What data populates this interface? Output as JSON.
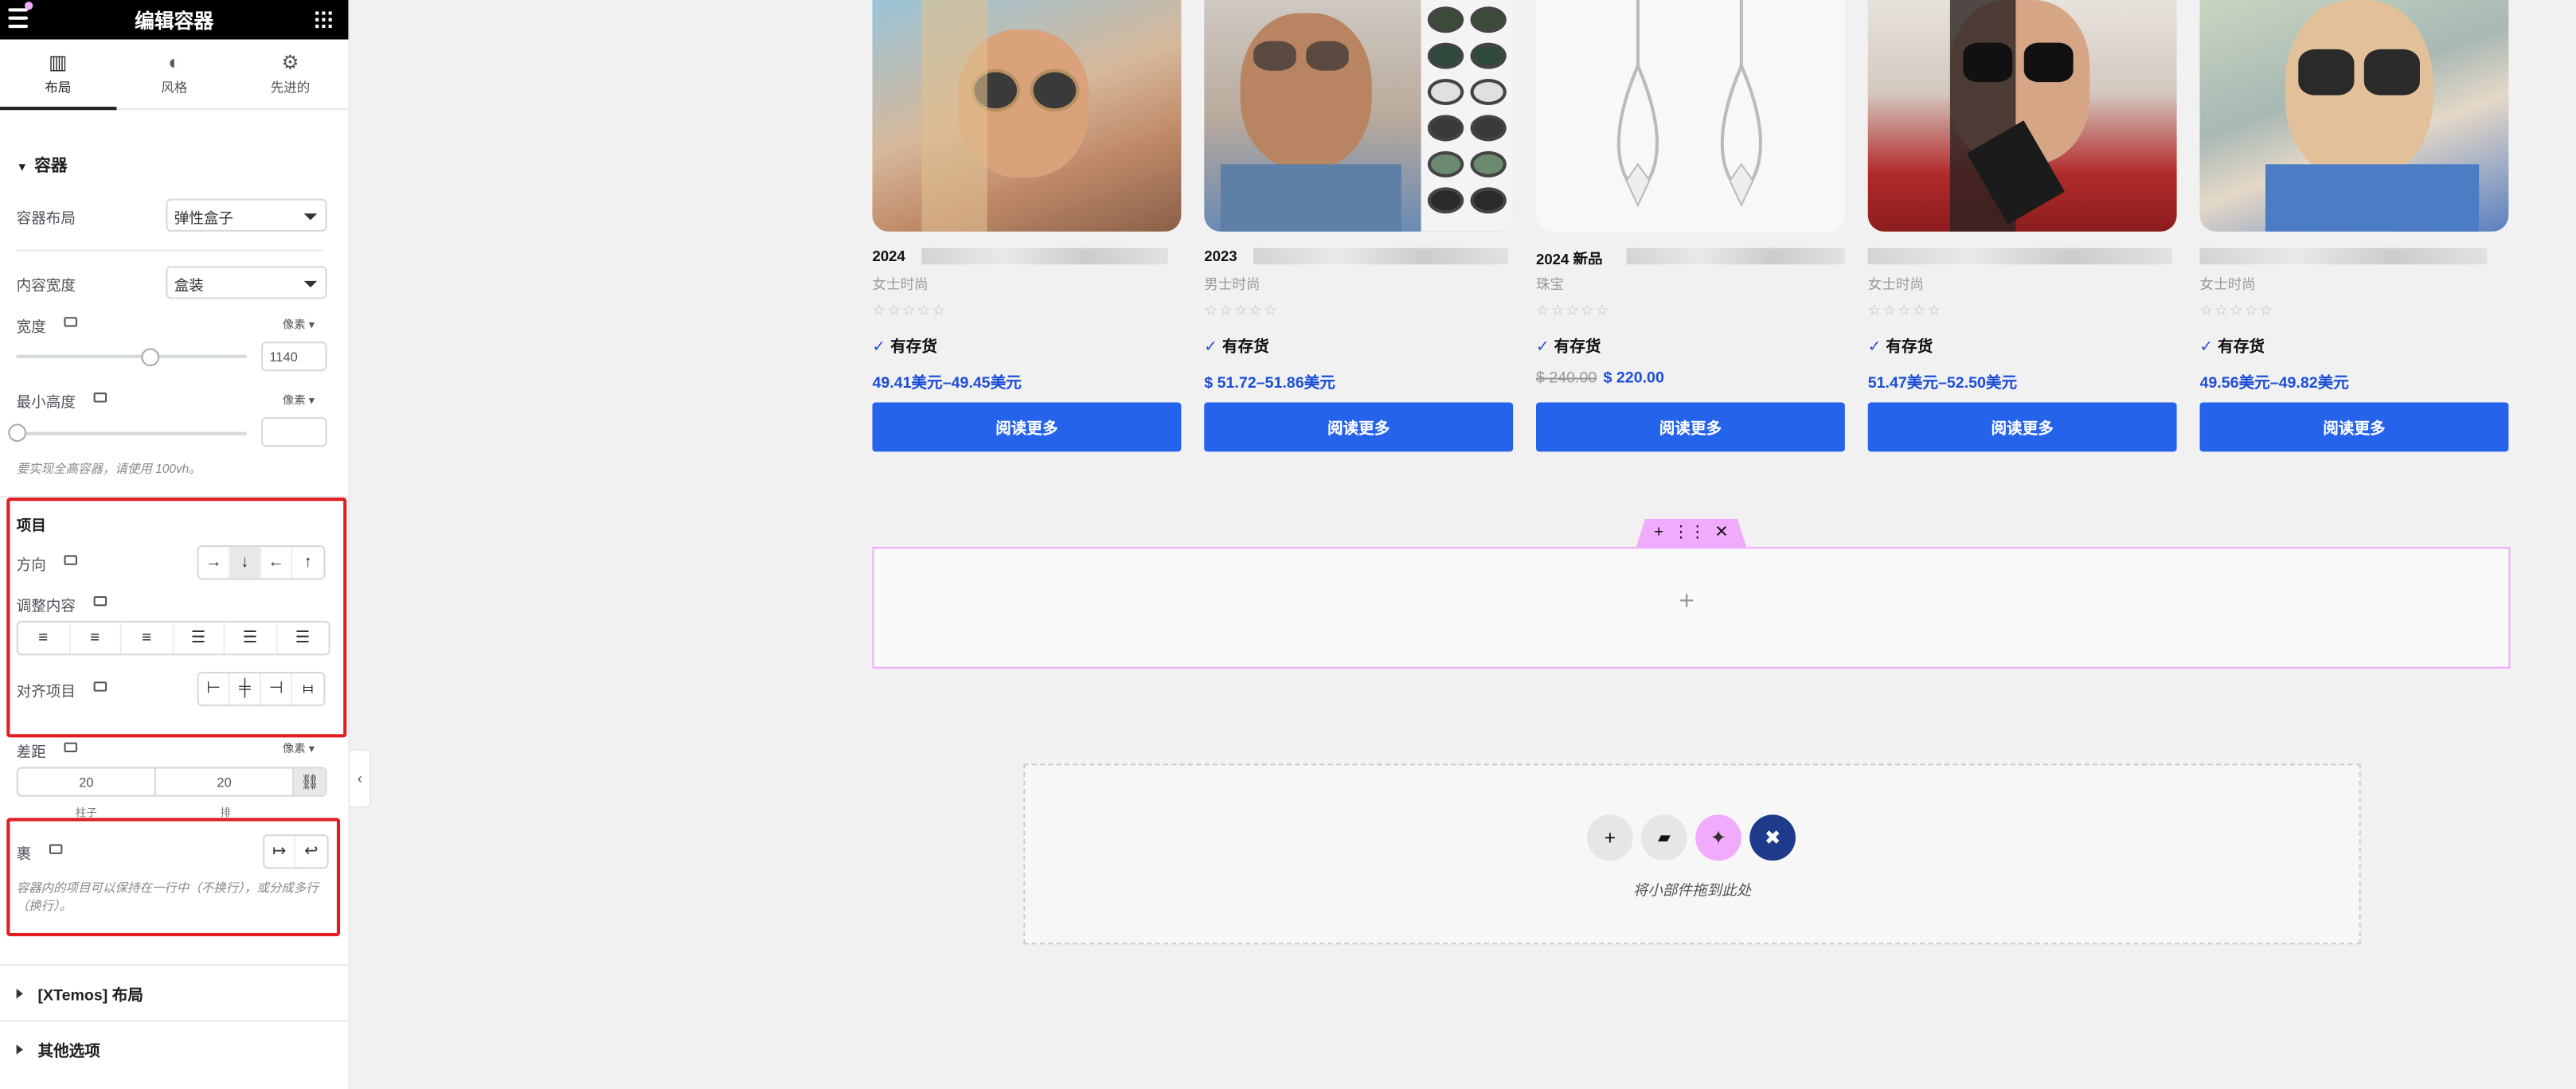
{
  "panel": {
    "title": "编辑容器",
    "tabs": [
      {
        "label": "布局",
        "icon": "layout-icon"
      },
      {
        "label": "风格",
        "icon": "half-circle-icon"
      },
      {
        "label": "先进的",
        "icon": "gear-icon"
      }
    ],
    "section_title": "容器",
    "container_layout": {
      "label": "容器布局",
      "value": "弹性盒子"
    },
    "content_width": {
      "label": "内容宽度",
      "value": "盒装"
    },
    "width": {
      "label": "宽度",
      "unit": "像素",
      "value": "1140",
      "slider_fraction": 0.58
    },
    "min_height": {
      "label": "最小高度",
      "unit": "像素",
      "value": "",
      "slider_fraction": 0
    },
    "min_height_note": "要实现全高容器，请使用 100vh。",
    "items_title": "项目",
    "direction": {
      "label": "方向",
      "options": [
        "→",
        "↓",
        "←",
        "↑"
      ],
      "selected": 1
    },
    "justify": {
      "label": "调整内容"
    },
    "align": {
      "label": "对齐项目"
    },
    "gap": {
      "label": "差距",
      "unit": "像素",
      "column_value": "20",
      "row_value": "20",
      "column_label": "柱子",
      "row_label": "排"
    },
    "wrap": {
      "label": "裹",
      "note": "容器内的项目可以保持在一行中（不换行），或分成多行（换行）。"
    },
    "collapsed_sections": [
      "[XTemos] 布局",
      "其他选项"
    ]
  },
  "products": [
    {
      "title": "2024",
      "category": "女士时尚",
      "stock": "有存货",
      "price": "49.41美元–49.45美元",
      "old_price": "",
      "button": "阅读更多"
    },
    {
      "title": "2023",
      "category": "男士时尚",
      "stock": "有存货",
      "price": "$ 51.72–51.86美元",
      "old_price": "",
      "button": "阅读更多"
    },
    {
      "title": "2024 新品",
      "category": "珠宝",
      "stock": "有存货",
      "price": "$ 220.00",
      "old_price": "$ 240.00",
      "button": "阅读更多"
    },
    {
      "title": "",
      "category": "女士时尚",
      "stock": "有存货",
      "price": "51.47美元–52.50美元",
      "old_price": "",
      "button": "阅读更多"
    },
    {
      "title": "",
      "category": "女士时尚",
      "stock": "有存货",
      "price": "49.56美元–49.82美元",
      "old_price": "",
      "button": "阅读更多"
    }
  ],
  "stars": "☆☆☆☆☆",
  "container_toolbar": {
    "add": "+",
    "drag": "⋮⋮",
    "close": "✕"
  },
  "container_add": "+",
  "dropzone": {
    "text": "将小部件拖到此处"
  },
  "colors": {
    "accent": "#2563eb",
    "pink": "#f0abfc",
    "navy": "#1e3a8a"
  }
}
